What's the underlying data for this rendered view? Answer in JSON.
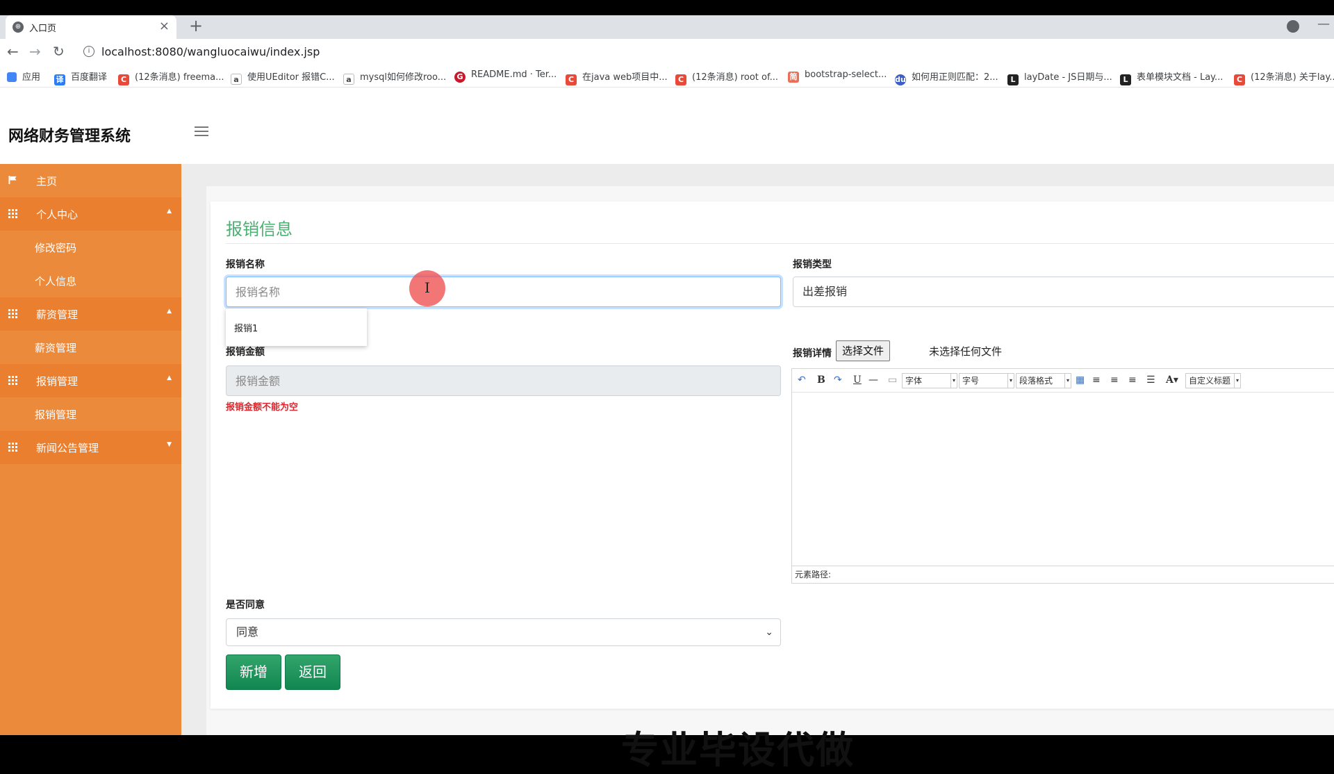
{
  "browser": {
    "tab_title": "入口页",
    "tab_close": "×",
    "new_tab": "+",
    "url": "localhost:8080/wangluocaiwu/index.jsp",
    "bookmarks": [
      {
        "label": "应用",
        "icon": "apps-grid-icon"
      },
      {
        "label": "百度翻译",
        "icon": "baidu-translate-icon"
      },
      {
        "label": "(12条消息) freema...",
        "icon": "csdn-icon"
      },
      {
        "label": "使用UEditor 报错C...",
        "icon": "page-icon"
      },
      {
        "label": "mysql如何修改roo...",
        "icon": "page-icon"
      },
      {
        "label": "README.md · Ter...",
        "icon": "gitee-icon"
      },
      {
        "label": "在java web项目中...",
        "icon": "csdn-icon"
      },
      {
        "label": "(12条消息) root of...",
        "icon": "csdn-icon"
      },
      {
        "label": "bootstrap-select...",
        "icon": "site-icon"
      },
      {
        "label": "如何用正则匹配：2...",
        "icon": "baidu-icon"
      },
      {
        "label": "layDate - JS日期与...",
        "icon": "layui-icon"
      },
      {
        "label": "表单模块文档 - Lay...",
        "icon": "layui-icon"
      },
      {
        "label": "(12条消息) 关于lay...",
        "icon": "csdn-icon"
      }
    ]
  },
  "header": {
    "app_title": "网络财务管理系统"
  },
  "sidebar": {
    "items": [
      {
        "label": "主页",
        "type": "top"
      },
      {
        "label": "个人中心",
        "type": "group"
      },
      {
        "label": "修改密码",
        "type": "sub"
      },
      {
        "label": "个人信息",
        "type": "sub"
      },
      {
        "label": "薪资管理",
        "type": "group"
      },
      {
        "label": "薪资管理",
        "type": "sub"
      },
      {
        "label": "报销管理",
        "type": "group"
      },
      {
        "label": "报销管理",
        "type": "sub"
      },
      {
        "label": "新闻公告管理",
        "type": "group"
      }
    ]
  },
  "form": {
    "title": "报销信息",
    "name_label": "报销名称",
    "name_placeholder": "报销名称",
    "autocomplete_option": "报销1",
    "type_label": "报销类型",
    "type_value": "出差报销",
    "amount_label": "报销金额",
    "amount_placeholder": "报销金额",
    "amount_error": "报销金额不能为空",
    "detail_label": "报销详情",
    "file_button": "选择文件",
    "file_status": "未选择任何文件",
    "editor": {
      "font_label": "字体",
      "size_label": "字号",
      "paragraph_label": "段落格式",
      "custom_title_label": "自定义标题",
      "path_label": "元素路径:"
    },
    "agree_label": "是否同意",
    "agree_value": "同意",
    "add_button": "新增",
    "back_button": "返回"
  },
  "overlay_text": "专业毕设代做",
  "colors": {
    "sidebar": "#ec8a3c",
    "title_green": "#4caf72",
    "button_green": "#1f9a5e",
    "error_red": "#e0232a"
  }
}
